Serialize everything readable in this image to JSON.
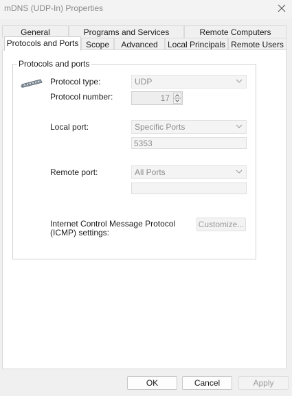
{
  "window": {
    "title": "mDNS (UDP-In) Properties"
  },
  "tabs_row1": [
    "General",
    "Programs and Services",
    "Remote Computers"
  ],
  "tabs_row2": [
    "Protocols and Ports",
    "Scope",
    "Advanced",
    "Local Principals",
    "Remote Users"
  ],
  "group": {
    "title": "Protocols and ports"
  },
  "protocol_type": {
    "label": "Protocol type:",
    "value": "UDP"
  },
  "protocol_number": {
    "label": "Protocol number:",
    "value": "17"
  },
  "local_port": {
    "label": "Local port:",
    "value": "Specific Ports",
    "ports": "5353"
  },
  "remote_port": {
    "label": "Remote port:",
    "value": "All Ports",
    "ports": ""
  },
  "icmp": {
    "label_line1": "Internet Control Message Protocol",
    "label_line2": "(ICMP) settings:",
    "button": "Customize..."
  },
  "footer": {
    "ok": "OK",
    "cancel": "Cancel",
    "apply": "Apply"
  },
  "icons": {
    "close": "close-icon",
    "chevron": "chevron-down-icon",
    "protocol": "network-cable-icon"
  }
}
